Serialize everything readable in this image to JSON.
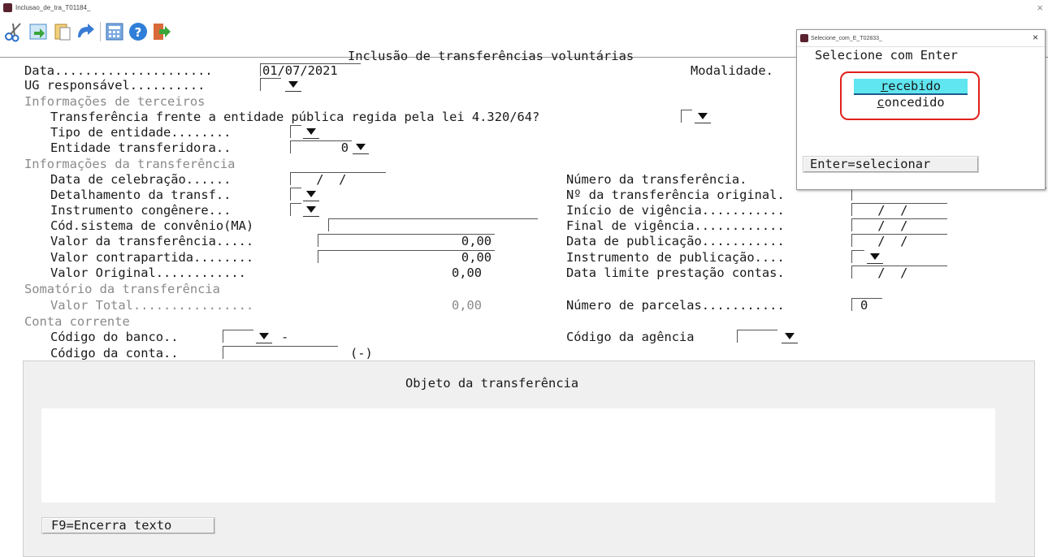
{
  "window": {
    "title": "Inclusao_de_tra_T01184_",
    "close_glyph": "×"
  },
  "toolbar": {
    "icons": [
      "scissors-icon",
      "import-icon",
      "paste-icon",
      "undo-icon",
      "calculator-icon",
      "help-icon",
      "exit-icon"
    ]
  },
  "form": {
    "header": "Inclusão de transferências voluntárias",
    "data_label": "Data.....................",
    "data_value": "01/07/2021",
    "modalidade_label": "Modalidade.",
    "ug_label": "UG responsável..........",
    "terceiros_section": "Informações de terceiros",
    "lei_label": "Transferência frente a entidade pública regida pela lei 4.320/64?",
    "tipo_entidade_label": "Tipo de entidade........",
    "entidade_transf_label": "Entidade transferidora..",
    "entidade_transf_value": "0",
    "transf_section": "Informações da transferência",
    "data_celebracao_label": "Data de celebração......",
    "data_celebracao_value": " /  /",
    "detalhamento_label": "Detalhamento da transf..",
    "instrumento_label": "Instrumento congênere...",
    "cod_sistema_label": "Cód.sistema de convênio(MA)",
    "valor_transf_label": "Valor da transferência.....",
    "valor_transf_value": "0,00",
    "valor_contra_label": "Valor contrapartida........",
    "valor_contra_value": "0,00",
    "valor_original_label": "Valor Original............",
    "valor_original_value": "0,00",
    "numero_transf_label": "Número da transferência.",
    "num_transf_original_label": "Nº da transferência original.",
    "inicio_vigencia_label": "Início de vigência...........",
    "final_vigencia_label": "Final de vigência............",
    "data_publicacao_label": "Data de publicação...........",
    "instrumento_pub_label": "Instrumento de publicação....",
    "data_limite_label": "Data limite prestação contas.",
    "date_empty": " /  /",
    "somatorio_section": "Somatório da transferência",
    "valor_total_label": "Valor Total................",
    "valor_total_value": "0,00",
    "numero_parcelas_label": "Número de parcelas...........",
    "numero_parcelas_value": "0",
    "conta_section": "Conta corrente",
    "codigo_banco_label": "Código do banco..",
    "banco_dash": "-",
    "codigo_agencia_label": "Código da agência",
    "codigo_conta_label": "Código da conta..",
    "conta_suffix": "(-)"
  },
  "objeto": {
    "title": "Objeto da transferência",
    "f9_button": "F9=Encerra texto"
  },
  "popup": {
    "window_title": "Selecione_com_E_T02833_",
    "close_glyph": "×",
    "header": "Selecione com Enter",
    "options": [
      {
        "hotkey": "r",
        "rest": "ecebido"
      },
      {
        "hotkey": "c",
        "rest": "oncedido"
      }
    ],
    "enter_button": "Enter=selecionar"
  }
}
